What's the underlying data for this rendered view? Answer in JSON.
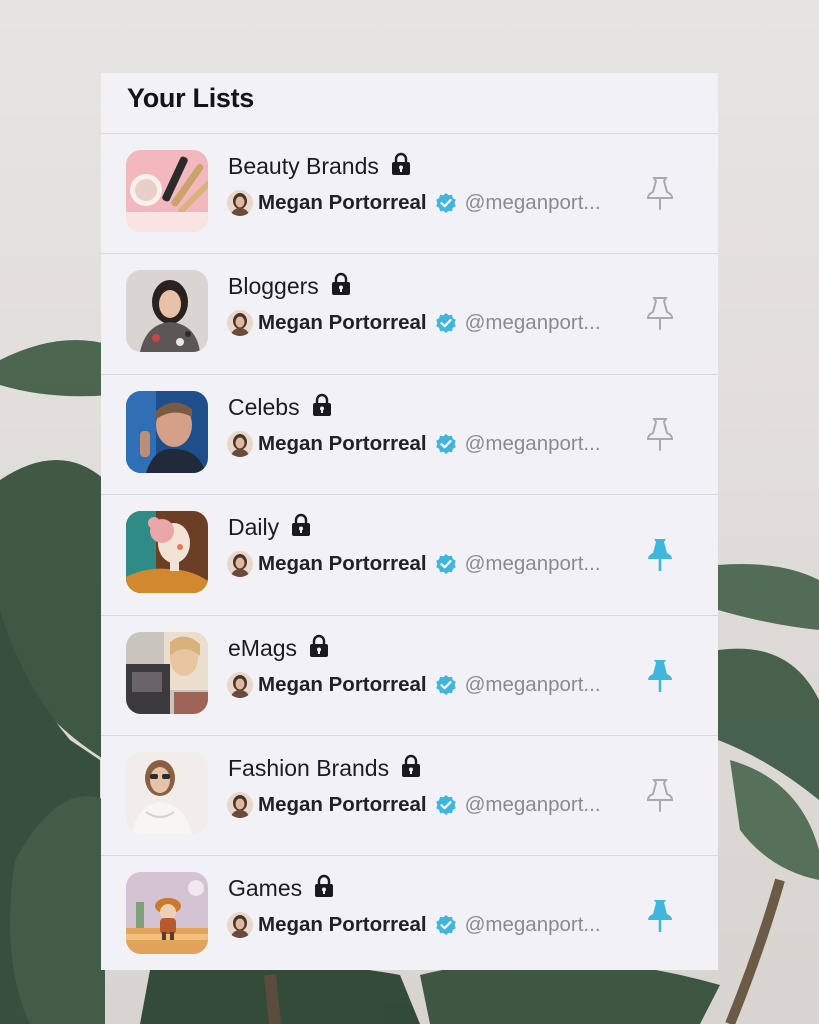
{
  "page": {
    "title": "Your Lists"
  },
  "colors": {
    "accent": "#3fb7dc",
    "pin_inactive": "#a9a9b0",
    "panel_bg": "#f2f2f6",
    "text_primary": "#1c1c20",
    "text_secondary": "#8a8a92"
  },
  "lists": [
    {
      "name": "Beauty Brands",
      "owner": "Megan Portorreal",
      "handle": "@meganport...",
      "private": true,
      "pinned": false,
      "thumb": "makeup-brushes"
    },
    {
      "name": "Bloggers",
      "owner": "Megan Portorreal",
      "handle": "@meganport...",
      "private": true,
      "pinned": false,
      "thumb": "woman-portrait"
    },
    {
      "name": "Celebs",
      "owner": "Megan Portorreal",
      "handle": "@meganport...",
      "private": true,
      "pinned": false,
      "thumb": "singer-portrait"
    },
    {
      "name": "Daily",
      "owner": "Megan Portorreal",
      "handle": "@meganport...",
      "private": true,
      "pinned": true,
      "thumb": "illustrated-woman"
    },
    {
      "name": "eMags",
      "owner": "Megan Portorreal",
      "handle": "@meganport...",
      "private": true,
      "pinned": true,
      "thumb": "magazine-collage"
    },
    {
      "name": "Fashion Brands",
      "owner": "Megan Portorreal",
      "handle": "@meganport...",
      "private": true,
      "pinned": false,
      "thumb": "smiling-model"
    },
    {
      "name": "Games",
      "owner": "Megan Portorreal",
      "handle": "@meganport...",
      "private": true,
      "pinned": true,
      "thumb": "game-character"
    }
  ],
  "icons": {
    "lock": "lock-icon",
    "verified": "verified-badge-icon",
    "pin": "pin-icon"
  }
}
